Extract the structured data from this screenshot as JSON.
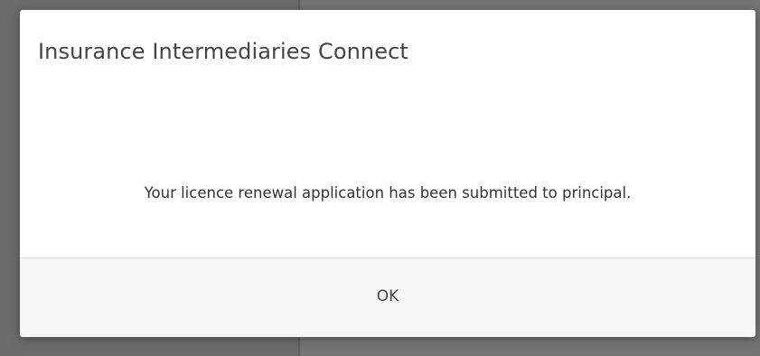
{
  "dialog": {
    "title": "Insurance Intermediaries Connect",
    "message": "Your licence renewal application has been submitted to principal.",
    "ok_label": "OK"
  }
}
